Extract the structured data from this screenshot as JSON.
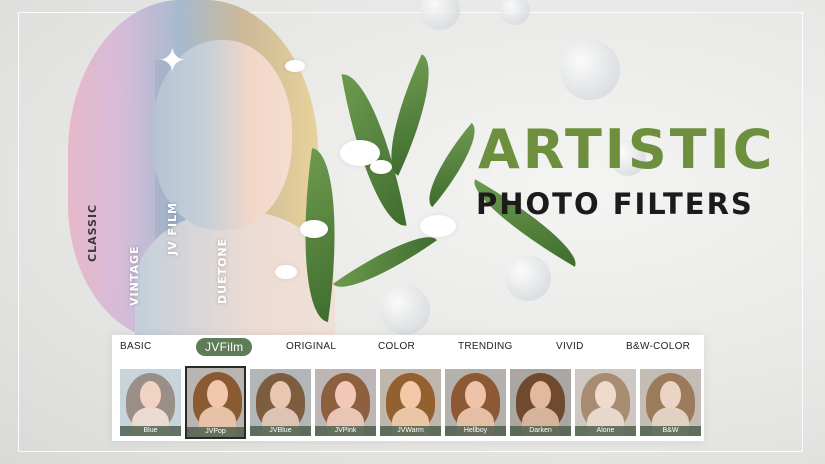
{
  "headline": {
    "line1": "ARTISTIC",
    "line2": "PHOTO FILTERS"
  },
  "hero_labels": [
    "CLASSIC",
    "VINTAGE",
    "JV FILM",
    "DUETONE"
  ],
  "categories": [
    {
      "label": "BASIC",
      "active": false
    },
    {
      "label": "JVFilm",
      "active": true
    },
    {
      "label": "ORIGINAL",
      "active": false
    },
    {
      "label": "COLOR",
      "active": false
    },
    {
      "label": "TRENDING",
      "active": false
    },
    {
      "label": "VIVID",
      "active": false
    },
    {
      "label": "B&W-COLOR",
      "active": false
    }
  ],
  "filters": [
    {
      "label": "Blue",
      "selected": false
    },
    {
      "label": "JVPop",
      "selected": true
    },
    {
      "label": "JVBlue",
      "selected": false
    },
    {
      "label": "JVPink",
      "selected": false
    },
    {
      "label": "JVWarm",
      "selected": false
    },
    {
      "label": "Hellboy",
      "selected": false
    },
    {
      "label": "Darken",
      "selected": false
    },
    {
      "label": "Alone",
      "selected": false
    },
    {
      "label": "B&W",
      "selected": false
    }
  ],
  "colors": {
    "accent_green": "#6e8f3d",
    "active_pill": "#5e7d57",
    "headline_dark": "#1b1b1b"
  }
}
